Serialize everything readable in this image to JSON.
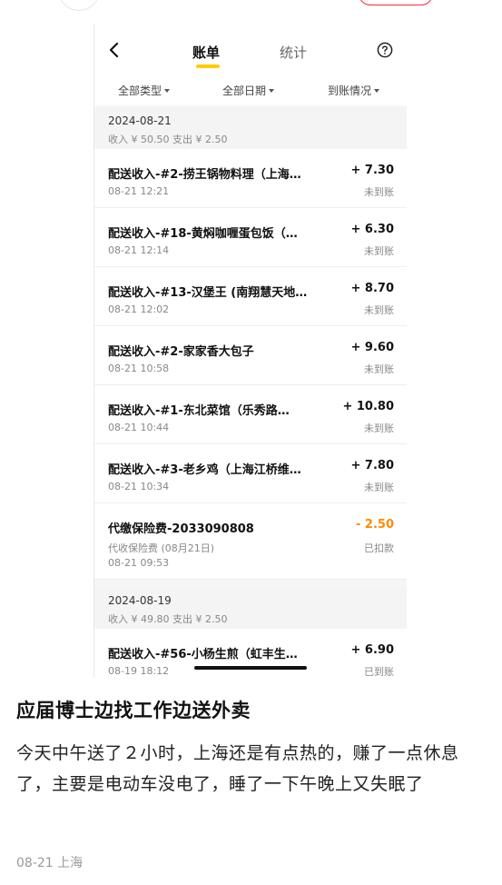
{
  "nav": {
    "tab_bill": "账单",
    "tab_stats": "统计",
    "back_icon": "chevron-left-icon",
    "help_icon": "question-circle-icon",
    "accent": "#ffcc00"
  },
  "filters": {
    "type": "全部类型",
    "date": "全部日期",
    "arrival": "到账情况"
  },
  "groups": [
    {
      "date": "2024-08-21",
      "summary": "收入 ¥ 50.50 支出 ¥ 2.50"
    },
    {
      "date": "2024-08-19",
      "summary": "收入 ¥ 49.80 支出 ¥ 2.50"
    }
  ],
  "rows": [
    {
      "title": "配送收入-#2-捞王锅物料理（上海…",
      "time": "08-21 12:21",
      "amount": "+ 7.30",
      "status": "未到账"
    },
    {
      "title": "配送收入-#18-黄焖咖喱蛋包饭（…",
      "time": "08-21 12:14",
      "amount": "+ 6.30",
      "status": "未到账"
    },
    {
      "title": "配送收入-#13-汉堡王 (南翔慧天地…",
      "time": "08-21 12:02",
      "amount": "+ 8.70",
      "status": "未到账"
    },
    {
      "title": "配送收入-#2-家家香大包子",
      "time": "08-21 10:58",
      "amount": "+ 9.60",
      "status": "未到账"
    },
    {
      "title": "配送收入-#1-东北菜馆（乐秀路…",
      "time": "08-21 10:44",
      "amount": "+ 10.80",
      "status": "未到账"
    },
    {
      "title": "配送收入-#3-老乡鸡（上海江桥维…",
      "time": "08-21 10:34",
      "amount": "+ 7.80",
      "status": "未到账"
    },
    {
      "title": "代缴保险费-2033090808",
      "note": "代收保险费 (08月21日)",
      "time": "08-21 09:53",
      "amount": "- 2.50",
      "status": "已扣款",
      "amount_color": "#ff8a00"
    },
    {
      "title": "配送收入-#56-小杨生煎（虹丰生…",
      "time": "08-19 18:12",
      "amount": "+ 6.90",
      "status": "已到账"
    }
  ],
  "post": {
    "title": "应届博士边找工作边送外卖",
    "body": "今天中午送了２小时，上海还是有点热的，赚了一点休息了，主要是电动车没电了，睡了一下午晚上又失眠了",
    "meta": "08-21 上海"
  }
}
